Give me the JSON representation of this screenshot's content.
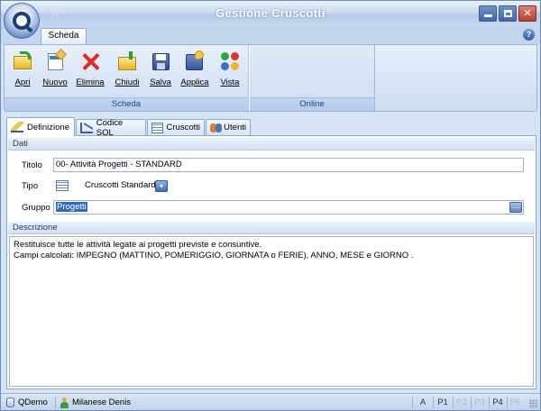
{
  "window": {
    "title": "Gestione Cruscotti"
  },
  "ribbon": {
    "tab": "Scheda",
    "groups": [
      {
        "label": "Scheda",
        "buttons": [
          {
            "label": "Apri",
            "icon": "folder-open-icon"
          },
          {
            "label": "Nuovo",
            "icon": "new-document-icon"
          },
          {
            "label": "Elimina",
            "icon": "delete-icon"
          },
          {
            "label": "Chiudi",
            "icon": "close-folder-icon"
          },
          {
            "label": "Salva",
            "icon": "save-icon"
          },
          {
            "label": "Applica",
            "icon": "apply-icon"
          },
          {
            "label": "Vista",
            "icon": "view-icon"
          }
        ]
      },
      {
        "label": "Online",
        "buttons": []
      }
    ]
  },
  "tabs": [
    {
      "label": "Definizione",
      "icon": "pencil-icon",
      "active": true
    },
    {
      "label": "Codice SQL",
      "icon": "chart-icon",
      "active": false
    },
    {
      "label": "Cruscotti",
      "icon": "grid-icon",
      "active": false
    },
    {
      "label": "Utenti",
      "icon": "users-icon",
      "active": false
    }
  ],
  "dati": {
    "section_label": "Dati",
    "titolo_label": "Titolo",
    "titolo_value": "00- Attività Progetti - STANDARD",
    "tipo_label": "Tipo",
    "tipo_value": "Cruscotti Standard",
    "gruppo_label": "Gruppo",
    "gruppo_value": "Progetti"
  },
  "descrizione": {
    "section_label": "Descrizione",
    "line1": "Restituisce tutte le attività legate ai progetti previste e consuntive.",
    "line2": "Campi calcolati: IMPEGNO (MATTINO, POMERIGGIO, GIORNATA o FERIE), ANNO, MESE e GIORNO ."
  },
  "statusbar": {
    "database": "QDemo",
    "user": "Milanese Denis",
    "indicators": [
      {
        "label": "A",
        "active": true
      },
      {
        "label": "P1",
        "active": true
      },
      {
        "label": "P2",
        "active": false
      },
      {
        "label": "P3",
        "active": false
      },
      {
        "label": "P4",
        "active": true
      },
      {
        "label": "P5",
        "active": false
      }
    ]
  },
  "colors": {
    "accent": "#316ac5",
    "frame": "#d5e3f4",
    "title_text": "#ffffff"
  }
}
